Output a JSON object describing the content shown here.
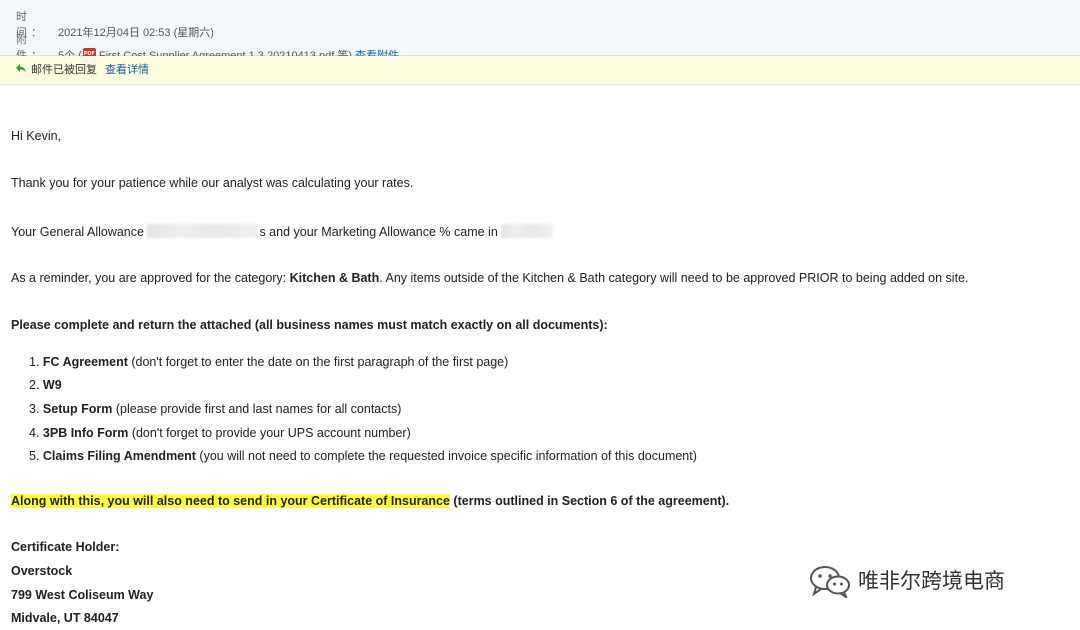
{
  "header": {
    "time_label": "时　间：",
    "time_value": "2021年12月04日 02:53 (星期六)",
    "attach_label": "附　件：",
    "attach_count": "5个 (",
    "attach_file": "First Cost Supplier Agreement 1.3 20210413.pdf 等)",
    "view_attachments": "查看附件"
  },
  "status_bar": {
    "replied_text": "邮件已被回复",
    "details_link": "查看详情"
  },
  "email": {
    "greeting": "Hi Kevin,",
    "thanks": "Thank you for your patience while our analyst was calculating your rates.",
    "allowance_prefix": "Your General Allowance",
    "allowance_mid": "s and your Marketing Allowance % came in",
    "reminder_prefix": "As a reminder, you are approved for the category: ",
    "reminder_category": "Kitchen & Bath",
    "reminder_suffix": ".  Any items outside of the Kitchen & Bath category will need to be approved PRIOR to being added on site.",
    "instructions": "Please complete and return the attached (all business names must match exactly on all documents):",
    "list": [
      {
        "num": "1.",
        "bold": "FC Agreement",
        "rest": " (don't forget to enter the date on the first paragraph of the first page)"
      },
      {
        "num": "2.",
        "bold": "W9",
        "rest": ""
      },
      {
        "num": "3.",
        "bold": "Setup Form",
        "rest": " (please provide first and last names for all contacts)"
      },
      {
        "num": "4.",
        "bold": "3PB Info Form",
        "rest": " (don't forget to provide your UPS account number)"
      },
      {
        "num": "5. ",
        "bold": "Claims Filing Amendment",
        "rest": " (you will not need to complete the requested invoice specific information of this document)"
      }
    ],
    "insurance_highlight": "Along with this, you will also need to send in your Certificate of Insurance",
    "insurance_rest": " (terms outlined in Section 6 of the agreement).",
    "holder_label": "Certificate Holder:",
    "holder_name": "Overstock",
    "holder_street": "799 West Coliseum Way",
    "holder_city": "Midvale, UT 84047"
  },
  "watermark": {
    "text": "唯非尔跨境电商",
    "icon": "wechat-icon"
  }
}
